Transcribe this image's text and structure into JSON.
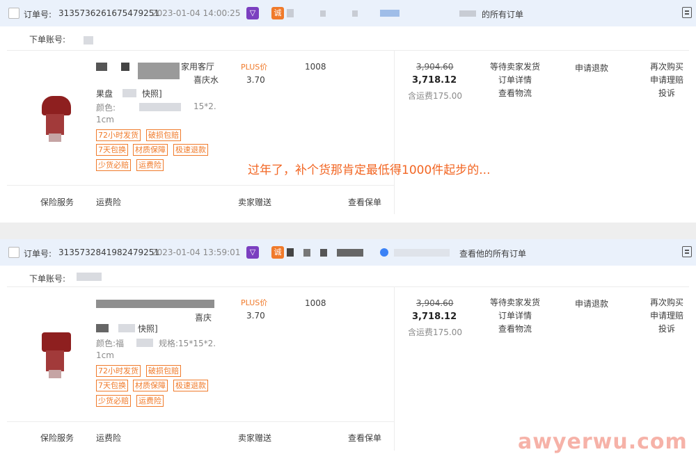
{
  "orders": [
    {
      "order_no_label": "订单号:",
      "order_no": "3135736261675479251",
      "time": "2023-01-04 14:00:25",
      "shop_link_text": "的所有订单",
      "account_label": "下单账号:",
      "title_part": "家用客厅",
      "title_part2": "喜庆水",
      "title_line3": "果盘",
      "title_line3b": "快照]",
      "spec_label": "颜色:",
      "spec_tail": "15*2.",
      "spec_line2": "1cm",
      "tags": [
        "72小时发货",
        "破损包赔",
        "7天包换",
        "材质保障",
        "极速退款",
        "少货必赔",
        "运费险"
      ],
      "plus_label": "PLUS价",
      "plus_price": "3.70",
      "quantity": "1008",
      "original_price": "3,904.60",
      "paid_price": "3,718.12",
      "shipping_note": "含运费175.00",
      "status": "等待卖家发货",
      "detail_link": "订单详情",
      "logistics_link": "查看物流",
      "refund_link": "申请退款",
      "rebuy_link": "再次购买",
      "claim_link": "申请理赔",
      "complain_link": "投诉",
      "services": {
        "insurance": "保险服务",
        "freight": "运费险",
        "gift": "卖家赠送",
        "policy": "查看保单"
      }
    },
    {
      "order_no_label": "订单号:",
      "order_no": "3135732841982479251",
      "time": "2023-01-04 13:59:01",
      "shop_link_text": "查看他的所有订单",
      "account_label": "下单账号:",
      "title_part": "",
      "title_part2": "喜庆",
      "title_line3": "",
      "title_line3b": "快照]",
      "spec_label": "颜色:福",
      "spec_tail": "规格:15*15*2.",
      "spec_line2": "1cm",
      "tags": [
        "72小时发货",
        "破损包赔",
        "7天包换",
        "材质保障",
        "极速退款",
        "少货必赔",
        "运费险"
      ],
      "plus_label": "PLUS价",
      "plus_price": "3.70",
      "quantity": "1008",
      "original_price": "3,904.60",
      "paid_price": "3,718.12",
      "shipping_note": "含运费175.00",
      "status": "等待卖家发货",
      "detail_link": "订单详情",
      "logistics_link": "查看物流",
      "refund_link": "申请退款",
      "rebuy_link": "再次购买",
      "claim_link": "申请理赔",
      "complain_link": "投诉",
      "services": {
        "insurance": "保险服务",
        "freight": "运费险",
        "gift": "卖家赠送",
        "policy": "查看保单"
      }
    }
  ],
  "annotation": "过年了，补个货那肯定最低得1000件起步的...",
  "watermark": "awyerwu.com",
  "colors": {
    "accent": "#f07a2a",
    "header_bg": "#eaf1fb",
    "annotation": "#f26522"
  },
  "icons": {
    "shop_a": "purple-shop-icon",
    "shop_b": "orange-shop-icon",
    "note": "note-icon"
  }
}
